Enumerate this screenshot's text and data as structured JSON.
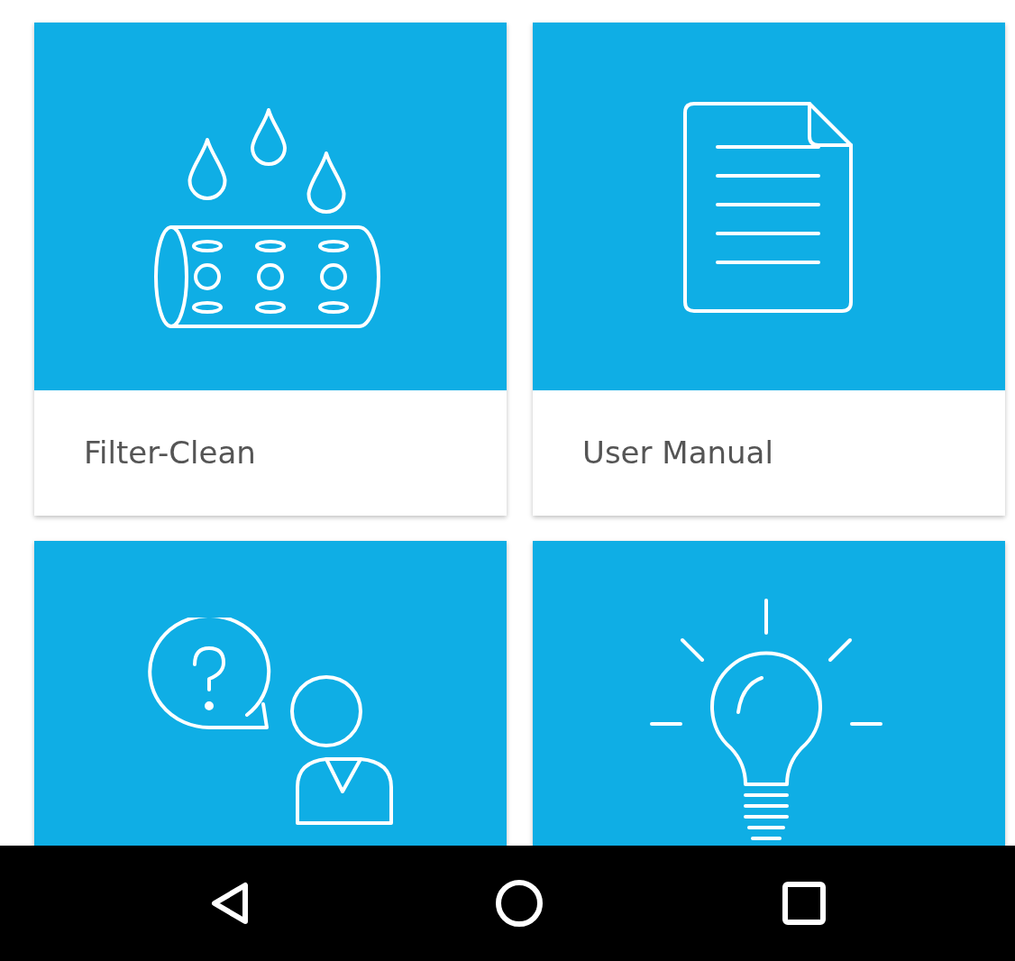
{
  "tiles": [
    {
      "kind": "filter",
      "label": "Filter-Clean"
    },
    {
      "kind": "document",
      "label": "User Manual"
    },
    {
      "kind": "support"
    },
    {
      "kind": "bulb"
    }
  ],
  "nav_bar": {
    "buttons": [
      {
        "kind": "back"
      },
      {
        "kind": "home"
      },
      {
        "kind": "recents"
      }
    ]
  }
}
